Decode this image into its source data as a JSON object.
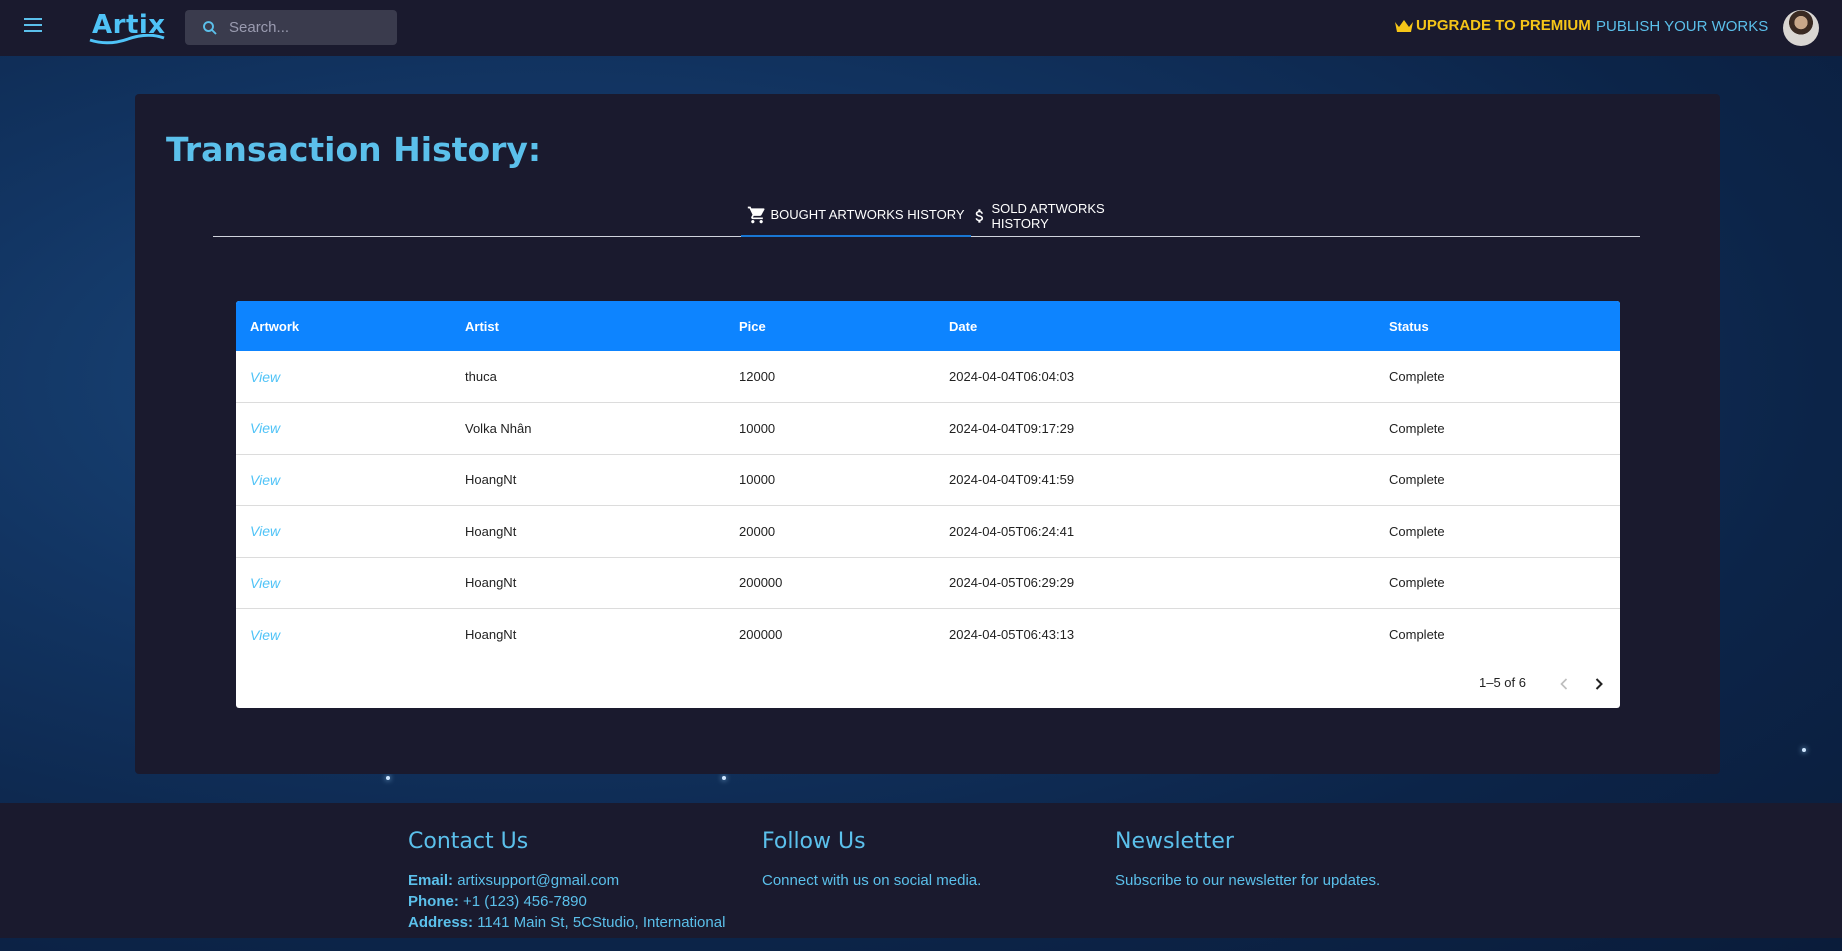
{
  "app": {
    "logo": "Artix"
  },
  "search": {
    "placeholder": "Search..."
  },
  "header": {
    "premium_label": "UPGRADE TO PREMIUM",
    "publish_label": "PUBLISH YOUR WORKS"
  },
  "page": {
    "title": "Transaction History:"
  },
  "tabs": [
    {
      "label": "BOUGHT ARTWORKS HISTORY",
      "icon": "cart-icon",
      "active": true
    },
    {
      "label": "SOLD ARTWORKS HISTORY",
      "icon": "dollar-icon",
      "active": false
    }
  ],
  "table": {
    "columns": [
      "Artwork",
      "Artist",
      "Pice",
      "Date",
      "Status"
    ],
    "rows": [
      {
        "artwork": "View",
        "artist": "thuca",
        "price": "12000",
        "date": "2024-04-04T06:04:03",
        "status": "Complete"
      },
      {
        "artwork": "View",
        "artist": "Volka Nhân",
        "price": "10000",
        "date": "2024-04-04T09:17:29",
        "status": "Complete"
      },
      {
        "artwork": "View",
        "artist": "HoangNt",
        "price": "10000",
        "date": "2024-04-04T09:41:59",
        "status": "Complete"
      },
      {
        "artwork": "View",
        "artist": "HoangNt",
        "price": "20000",
        "date": "2024-04-05T06:24:41",
        "status": "Complete"
      },
      {
        "artwork": "View",
        "artist": "HoangNt",
        "price": "200000",
        "date": "2024-04-05T06:29:29",
        "status": "Complete"
      },
      {
        "artwork": "View",
        "artist": "HoangNt",
        "price": "200000",
        "date": "2024-04-05T06:43:13",
        "status": "Complete"
      }
    ],
    "pagination": "1–5 of 6"
  },
  "footer": {
    "contact": {
      "title": "Contact Us",
      "email_label": "Email:",
      "email": "artixsupport@gmail.com",
      "phone_label": "Phone:",
      "phone": "+1 (123) 456-7890",
      "address_label": "Address:",
      "address": "1141 Main St, 5CStudio, International"
    },
    "follow": {
      "title": "Follow Us",
      "text": "Connect with us on social media."
    },
    "newsletter": {
      "title": "Newsletter",
      "text": "Subscribe to our newsletter for updates."
    }
  },
  "colors": {
    "accent": "#5bc0eb",
    "premium": "#f5c518",
    "table_header": "#0d84ff",
    "panel": "#1a1a2e"
  }
}
